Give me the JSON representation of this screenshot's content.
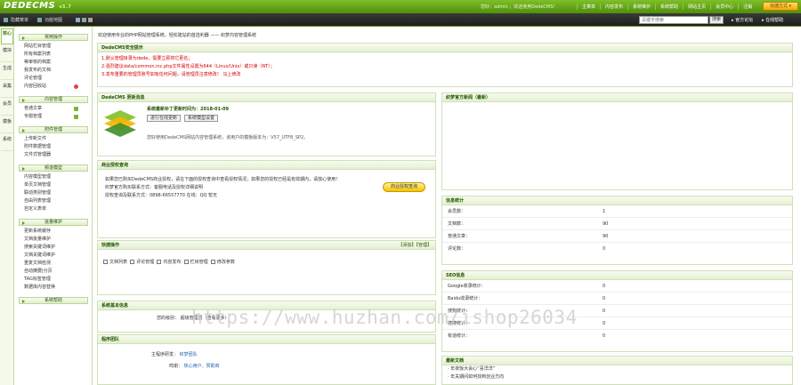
{
  "header": {
    "logo": "DEDECMS",
    "version": "v5.7",
    "user_info": "您好：admin ，欢迎使用DedeCMS！",
    "nav": [
      "主菜单",
      "内容发布",
      "系统维护",
      "系统帮助",
      "网站主页",
      "会员中心",
      "注销"
    ],
    "quick_button": "快捷方式 ▾"
  },
  "toolbar": {
    "tabs": [
      "隐藏菜单",
      "功能地图"
    ],
    "search_placeholder": "关键字搜索",
    "search_button": "搜索",
    "links": [
      "官方论坛",
      "在线帮助"
    ]
  },
  "vtabs": [
    "核心",
    "模块",
    "生成",
    "采集",
    "会员",
    "模板",
    "系统"
  ],
  "menu": [
    {
      "title": "常用操作",
      "items": [
        "网站栏目管理",
        "所有档案列表",
        "等审核的档案",
        "我发布的文档",
        "评论管理",
        "内容回收站"
      ]
    },
    {
      "title": "内容管理",
      "items": [
        "普通文章",
        "专题管理"
      ]
    },
    {
      "title": "附件管理",
      "items": [
        "上传新文件",
        "附件数据管理",
        "文件式管理器"
      ]
    },
    {
      "title": "频道模型",
      "items": [
        "内容模型管理",
        "单页文档管理",
        "联动类别管理",
        "自由列表管理",
        "自定义表单"
      ]
    },
    {
      "title": "批量维护",
      "items": [
        "更新系统缓存",
        "文档批量维护",
        "搜索关键词维护",
        "文档关键词维护",
        "重复文档检测",
        "自动摘要|分页",
        "TAG标签管理",
        "数据库内容替换"
      ]
    },
    {
      "title": "系统帮助",
      "items": []
    }
  ],
  "breadcrumb": "欢迎使用专业的PHP网站管理系统，轻松建站的首选利器 —— 织梦内容管理系统",
  "security": {
    "title": "DedeCMS安全提示",
    "lines": [
      "1.默认管理目录为dede，需要立即将它更名；",
      "2.强烈建议data/common.inc.php文件属性设置为644（Linux/Unix）或只读（NT）；",
      "3.发布重要的管理员账号如有任何问题，请管理员注意修改！ 马上修改"
    ]
  },
  "update": {
    "title": "DedeCMS 更新消息",
    "headline": "系统最新补丁更新时间为：2018-01-09",
    "btn1": "进行在线更新",
    "btn2": "系统模型设置",
    "desc": "您好使用DedeCMS网站内容管理系统，该用户的模板版本为：V57_UTF8_SP2。"
  },
  "license": {
    "title": "商业授权查询",
    "lines": [
      "如果您已购买DedeCMS商业授权，请在下面的授权查询中查看授权情况，如果您的授权已经是有效期内，请放心使用！",
      "织梦官方购买联系方式：客服电话及授权详细说明",
      "授权查询及联系方式：0898-66557770 在线：QQ 暂无"
    ],
    "button": "商业授权查询"
  },
  "quick": {
    "title": "快捷操作",
    "right": "【添加】【管理】",
    "items": [
      "文档列表",
      "评论管理",
      "内容发布",
      "栏目管理",
      "修改参数"
    ]
  },
  "sysinfo": {
    "title": "系统基本信息",
    "row": "您的级别：  超级管理员（查看更多）"
  },
  "team": {
    "title": "程序团队",
    "rows": [
      [
        "主程序研发：",
        "织梦团队"
      ],
      [
        "鸣谢：",
        "热心用户、赞助商"
      ]
    ]
  },
  "news": {
    "title": "织梦官方新闻（最新）"
  },
  "stats": {
    "title": "信息统计",
    "rows": [
      [
        "会员数：",
        "1"
      ],
      [
        "文档数：",
        "90"
      ],
      [
        "普通文章：",
        "90"
      ],
      [
        "评论数：",
        "0"
      ]
    ]
  },
  "seo": {
    "title": "SEO信息",
    "rows": [
      [
        "Google收录统计：",
        "0"
      ],
      [
        "Baidu收录统计：",
        "0"
      ],
      [
        "搜狗统计：",
        "0"
      ],
      [
        "搜搜统计：",
        "0"
      ],
      [
        "有道统计：",
        "0"
      ]
    ]
  },
  "docs": {
    "title": "最新文档",
    "items": [
      "· 年夜饭大会心“喜洋洋”",
      "· 年关期间如何找到创业方向",
      "· 购买前需要掌握的事"
    ]
  },
  "watermark": "https://www.huzhan.com/ishop26034"
}
